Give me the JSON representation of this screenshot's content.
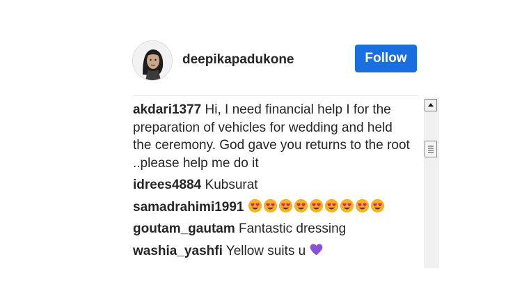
{
  "post": {
    "username": "deepikapadukone",
    "follow_label": "Follow"
  },
  "comments": [
    {
      "user": "akdari1377",
      "text": "Hi, I need financial help I for the preparation of vehicles for wedding and held the ceremony. God gave you returns to the root ..please help me do it"
    },
    {
      "user": "idrees4884",
      "text": "Kubsurat"
    },
    {
      "user": "samadrahimi1991",
      "text": "",
      "emoji": "heart-eyes-emoji",
      "emoji_count": 9
    },
    {
      "user": "goutam_gautam",
      "text": "Fantastic dressing"
    },
    {
      "user": "washia_yashfi",
      "text": "Yellow suits u",
      "emoji": "purple-heart-emoji",
      "emoji_count": 1
    }
  ],
  "colors": {
    "follow_button": "#1a6fe0",
    "heart_eyes_face": "#f5b324",
    "heart_eyes_hearts": "#e0245e",
    "purple_heart": "#8b4fd8"
  }
}
